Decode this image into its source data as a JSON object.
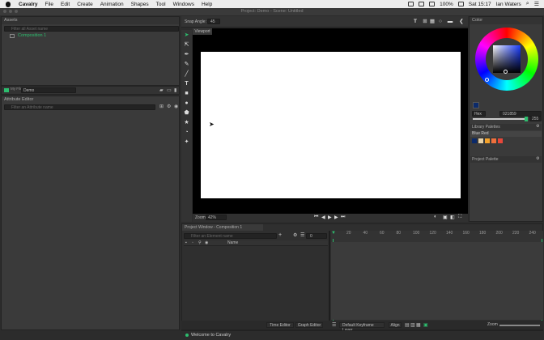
{
  "menubar": {
    "app": "Cavalry",
    "items": [
      "File",
      "Edit",
      "Create",
      "Animation",
      "Shapes",
      "Tool",
      "Windows",
      "Help"
    ],
    "battery": "100%",
    "clock": "Sat 15:17",
    "user": "Ian Waters"
  },
  "window": {
    "title": "Project: Demo - Scene: Untitled"
  },
  "assets": {
    "title": "Assets",
    "search_placeholder": "Filter all Asset name",
    "item": "Composition 1"
  },
  "file_tree": {
    "label": "My Files",
    "value": "Demo"
  },
  "attribute_editor": {
    "title": "Attribute Editor",
    "search_placeholder": "Filter an Attribute name"
  },
  "toolbar": {
    "snap_label": "Snap Angle:",
    "snap_value": "45"
  },
  "viewport": {
    "tab": "Viewport",
    "zoom_label": "Zoom",
    "zoom_value": "42%"
  },
  "color_panel": {
    "title": "Color",
    "hex_label": "Hex",
    "hex_value": "021859",
    "alpha_value": "255"
  },
  "library": {
    "title": "Library Palettes",
    "palette": "Blue Red",
    "swatches": [
      "#0b2a6a",
      "#e8d2a8",
      "#f4a22b",
      "#f0703c",
      "#e8473a"
    ]
  },
  "project_palette": {
    "title": "Project Palette"
  },
  "project_window": {
    "title": "Project Window - Composition 1",
    "filter_placeholder": "Filter an Element name",
    "frame_value": "0",
    "name_header": "Name"
  },
  "timeline": {
    "ticks": [
      "20",
      "40",
      "60",
      "80",
      "100",
      "120",
      "140",
      "160",
      "180",
      "200",
      "220",
      "240"
    ]
  },
  "bottom_tabs": {
    "time_editor": "Time Editor",
    "graph_editor": "Graph Editor",
    "keyframe_layer": "Default Keyframe Layer",
    "align": "Align",
    "zoom": "Zoom"
  },
  "status": {
    "message": "Welcome to Cavalry"
  },
  "colors": {
    "accent": "#2dbd6e",
    "selection": "#0b2a6a",
    "bg": "#2c2c2c"
  }
}
